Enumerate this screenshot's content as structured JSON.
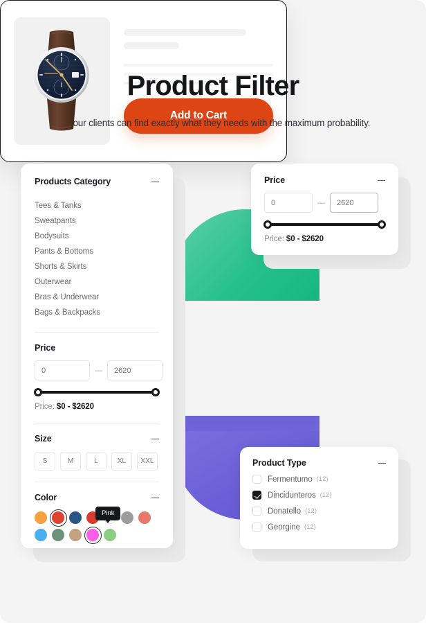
{
  "header": {
    "title": "Product Filter",
    "subtitle": "All your clients can find exactly what they needs with the maximum probability."
  },
  "colors": {
    "accent": "#dd4514",
    "ink": "#17181c",
    "page_bg": "#f4f4f4",
    "blob_green": "#21bd8a",
    "blob_purple": "#6a5fd6"
  },
  "left_panel": {
    "category": {
      "title": "Products Category",
      "collapse_icon": "minus-icon",
      "items": [
        "Tees & Tanks",
        "Sweatpants",
        "Bodysuits",
        "Pants & Bottoms",
        "Shorts & Skirts",
        "Outerwear",
        "Bras & Underwear",
        "Bags & Backpacks"
      ]
    },
    "price": {
      "title": "Price",
      "min_value": "0",
      "min_placeholder": "0",
      "max_value": "2620",
      "max_placeholder": "2620",
      "separator": "—",
      "label_prefix": "Price:",
      "label_value": "$0 - $2620"
    },
    "size": {
      "title": "Size",
      "collapse_icon": "minus-icon",
      "options": [
        "S",
        "M",
        "L",
        "XL",
        "XXL"
      ]
    },
    "color": {
      "title": "Color",
      "collapse_icon": "minus-icon",
      "tooltip": "Pink",
      "row1": [
        {
          "name": "orange",
          "hex": "#f3a23f",
          "selected": false,
          "light_ring": false
        },
        {
          "name": "red",
          "hex": "#e04232",
          "selected": true,
          "light_ring": false
        },
        {
          "name": "navy",
          "hex": "#2a5683",
          "selected": false,
          "light_ring": false
        },
        {
          "name": "crimson",
          "hex": "#d93c2c",
          "selected": false,
          "light_ring": false
        },
        {
          "name": "white",
          "hex": "#ffffff",
          "selected": false,
          "light_ring": true
        },
        {
          "name": "grey",
          "hex": "#9d9d9d",
          "selected": false,
          "light_ring": false
        },
        {
          "name": "salmon",
          "hex": "#e8796a",
          "selected": false,
          "light_ring": false
        }
      ],
      "row2": [
        {
          "name": "sky-blue",
          "hex": "#4aaef0",
          "selected": false,
          "light_ring": false
        },
        {
          "name": "sage-green",
          "hex": "#6d9279",
          "selected": false,
          "light_ring": false
        },
        {
          "name": "tan",
          "hex": "#c3a183",
          "selected": false,
          "light_ring": false
        },
        {
          "name": "pink",
          "hex": "#f95ee8",
          "selected": true,
          "light_ring": false
        },
        {
          "name": "light-green",
          "hex": "#8ccd82",
          "selected": false,
          "light_ring": false
        }
      ]
    }
  },
  "price_panel": {
    "title": "Price",
    "collapse_icon": "minus-icon",
    "min_value": "0",
    "min_placeholder": "0",
    "max_value": "2620",
    "max_placeholder": "2620",
    "separator": "—",
    "label_prefix": "Price:",
    "label_value": "$0 - $2620"
  },
  "product_type_panel": {
    "title": "Product Type",
    "collapse_icon": "minus-icon",
    "items": [
      {
        "label": "Fermentumo",
        "count": "(12)",
        "checked": false
      },
      {
        "label": "Dincidunteros",
        "count": "(12)",
        "checked": true
      },
      {
        "label": "Donatello",
        "count": "(12)",
        "checked": false
      },
      {
        "label": "Georgine",
        "count": "(12)",
        "checked": false
      }
    ]
  },
  "product_card": {
    "image_alt": "chronograph-watch",
    "add_to_cart_label": "Add to Cart"
  }
}
